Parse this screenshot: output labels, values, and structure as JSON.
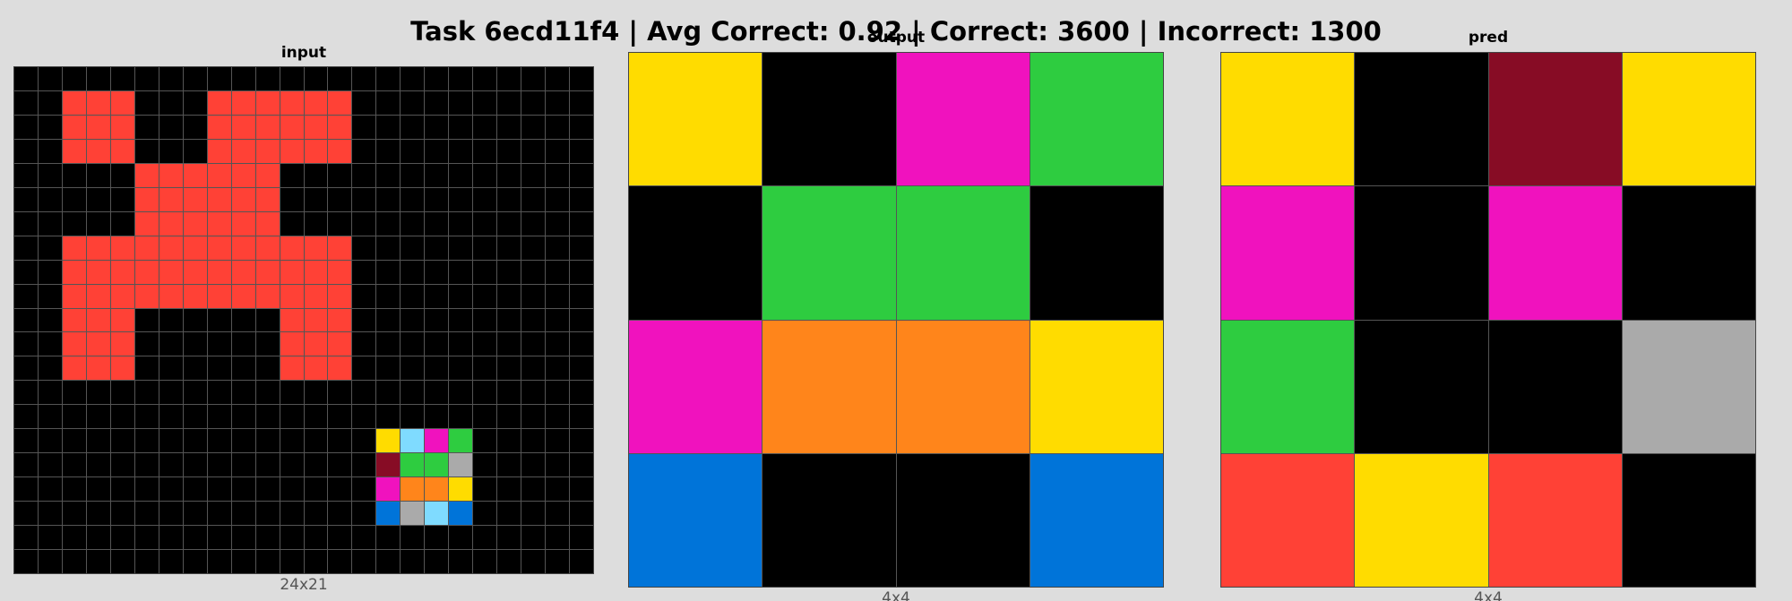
{
  "title": "Task 6ecd11f4 | Avg Correct: 0.92 | Correct: 3600 | Incorrect: 1300",
  "palette": {
    "0": "#000000",
    "1": "#0074d9",
    "2": "#ff4136",
    "3": "#2ecc40",
    "4": "#ffdc00",
    "5": "#aaaaaa",
    "6": "#f012be",
    "7": "#ff851b",
    "8": "#7fdbff",
    "9": "#870c25"
  },
  "panels": {
    "input": {
      "label": "input",
      "dims": "24x21",
      "rows": [
        [
          0,
          0,
          0,
          0,
          0,
          0,
          0,
          0,
          0,
          0,
          0,
          0,
          0,
          0,
          0,
          0,
          0,
          0,
          0,
          0,
          0,
          0,
          0,
          0
        ],
        [
          0,
          0,
          2,
          2,
          2,
          0,
          0,
          0,
          2,
          2,
          2,
          2,
          2,
          2,
          0,
          0,
          0,
          0,
          0,
          0,
          0,
          0,
          0,
          0
        ],
        [
          0,
          0,
          2,
          2,
          2,
          0,
          0,
          0,
          2,
          2,
          2,
          2,
          2,
          2,
          0,
          0,
          0,
          0,
          0,
          0,
          0,
          0,
          0,
          0
        ],
        [
          0,
          0,
          2,
          2,
          2,
          0,
          0,
          0,
          2,
          2,
          2,
          2,
          2,
          2,
          0,
          0,
          0,
          0,
          0,
          0,
          0,
          0,
          0,
          0
        ],
        [
          0,
          0,
          0,
          0,
          0,
          2,
          2,
          2,
          2,
          2,
          2,
          0,
          0,
          0,
          0,
          0,
          0,
          0,
          0,
          0,
          0,
          0,
          0,
          0
        ],
        [
          0,
          0,
          0,
          0,
          0,
          2,
          2,
          2,
          2,
          2,
          2,
          0,
          0,
          0,
          0,
          0,
          0,
          0,
          0,
          0,
          0,
          0,
          0,
          0
        ],
        [
          0,
          0,
          0,
          0,
          0,
          2,
          2,
          2,
          2,
          2,
          2,
          0,
          0,
          0,
          0,
          0,
          0,
          0,
          0,
          0,
          0,
          0,
          0,
          0
        ],
        [
          0,
          0,
          2,
          2,
          2,
          2,
          2,
          2,
          2,
          2,
          2,
          2,
          2,
          2,
          0,
          0,
          0,
          0,
          0,
          0,
          0,
          0,
          0,
          0
        ],
        [
          0,
          0,
          2,
          2,
          2,
          2,
          2,
          2,
          2,
          2,
          2,
          2,
          2,
          2,
          0,
          0,
          0,
          0,
          0,
          0,
          0,
          0,
          0,
          0
        ],
        [
          0,
          0,
          2,
          2,
          2,
          2,
          2,
          2,
          2,
          2,
          2,
          2,
          2,
          2,
          0,
          0,
          0,
          0,
          0,
          0,
          0,
          0,
          0,
          0
        ],
        [
          0,
          0,
          2,
          2,
          2,
          0,
          0,
          0,
          0,
          0,
          0,
          2,
          2,
          2,
          0,
          0,
          0,
          0,
          0,
          0,
          0,
          0,
          0,
          0
        ],
        [
          0,
          0,
          2,
          2,
          2,
          0,
          0,
          0,
          0,
          0,
          0,
          2,
          2,
          2,
          0,
          0,
          0,
          0,
          0,
          0,
          0,
          0,
          0,
          0
        ],
        [
          0,
          0,
          2,
          2,
          2,
          0,
          0,
          0,
          0,
          0,
          0,
          2,
          2,
          2,
          0,
          0,
          0,
          0,
          0,
          0,
          0,
          0,
          0,
          0
        ],
        [
          0,
          0,
          0,
          0,
          0,
          0,
          0,
          0,
          0,
          0,
          0,
          0,
          0,
          0,
          0,
          0,
          0,
          0,
          0,
          0,
          0,
          0,
          0,
          0
        ],
        [
          0,
          0,
          0,
          0,
          0,
          0,
          0,
          0,
          0,
          0,
          0,
          0,
          0,
          0,
          0,
          0,
          0,
          0,
          0,
          0,
          0,
          0,
          0,
          0
        ],
        [
          0,
          0,
          0,
          0,
          0,
          0,
          0,
          0,
          0,
          0,
          0,
          0,
          0,
          0,
          0,
          4,
          8,
          6,
          3,
          0,
          0,
          0,
          0,
          0
        ],
        [
          0,
          0,
          0,
          0,
          0,
          0,
          0,
          0,
          0,
          0,
          0,
          0,
          0,
          0,
          0,
          9,
          3,
          3,
          5,
          0,
          0,
          0,
          0,
          0
        ],
        [
          0,
          0,
          0,
          0,
          0,
          0,
          0,
          0,
          0,
          0,
          0,
          0,
          0,
          0,
          0,
          6,
          7,
          7,
          4,
          0,
          0,
          0,
          0,
          0
        ],
        [
          0,
          0,
          0,
          0,
          0,
          0,
          0,
          0,
          0,
          0,
          0,
          0,
          0,
          0,
          0,
          1,
          5,
          8,
          1,
          0,
          0,
          0,
          0,
          0
        ],
        [
          0,
          0,
          0,
          0,
          0,
          0,
          0,
          0,
          0,
          0,
          0,
          0,
          0,
          0,
          0,
          0,
          0,
          0,
          0,
          0,
          0,
          0,
          0,
          0
        ],
        [
          0,
          0,
          0,
          0,
          0,
          0,
          0,
          0,
          0,
          0,
          0,
          0,
          0,
          0,
          0,
          0,
          0,
          0,
          0,
          0,
          0,
          0,
          0,
          0
        ]
      ]
    },
    "output": {
      "label": "output",
      "dims": "4x4",
      "rows": [
        [
          4,
          0,
          6,
          3
        ],
        [
          0,
          3,
          3,
          0
        ],
        [
          6,
          7,
          7,
          4
        ],
        [
          1,
          0,
          0,
          1
        ]
      ]
    },
    "pred": {
      "label": "pred",
      "dims": "4x4",
      "rows": [
        [
          4,
          0,
          9,
          4
        ],
        [
          6,
          0,
          6,
          0
        ],
        [
          3,
          0,
          0,
          5
        ],
        [
          2,
          4,
          2,
          0
        ]
      ]
    }
  }
}
